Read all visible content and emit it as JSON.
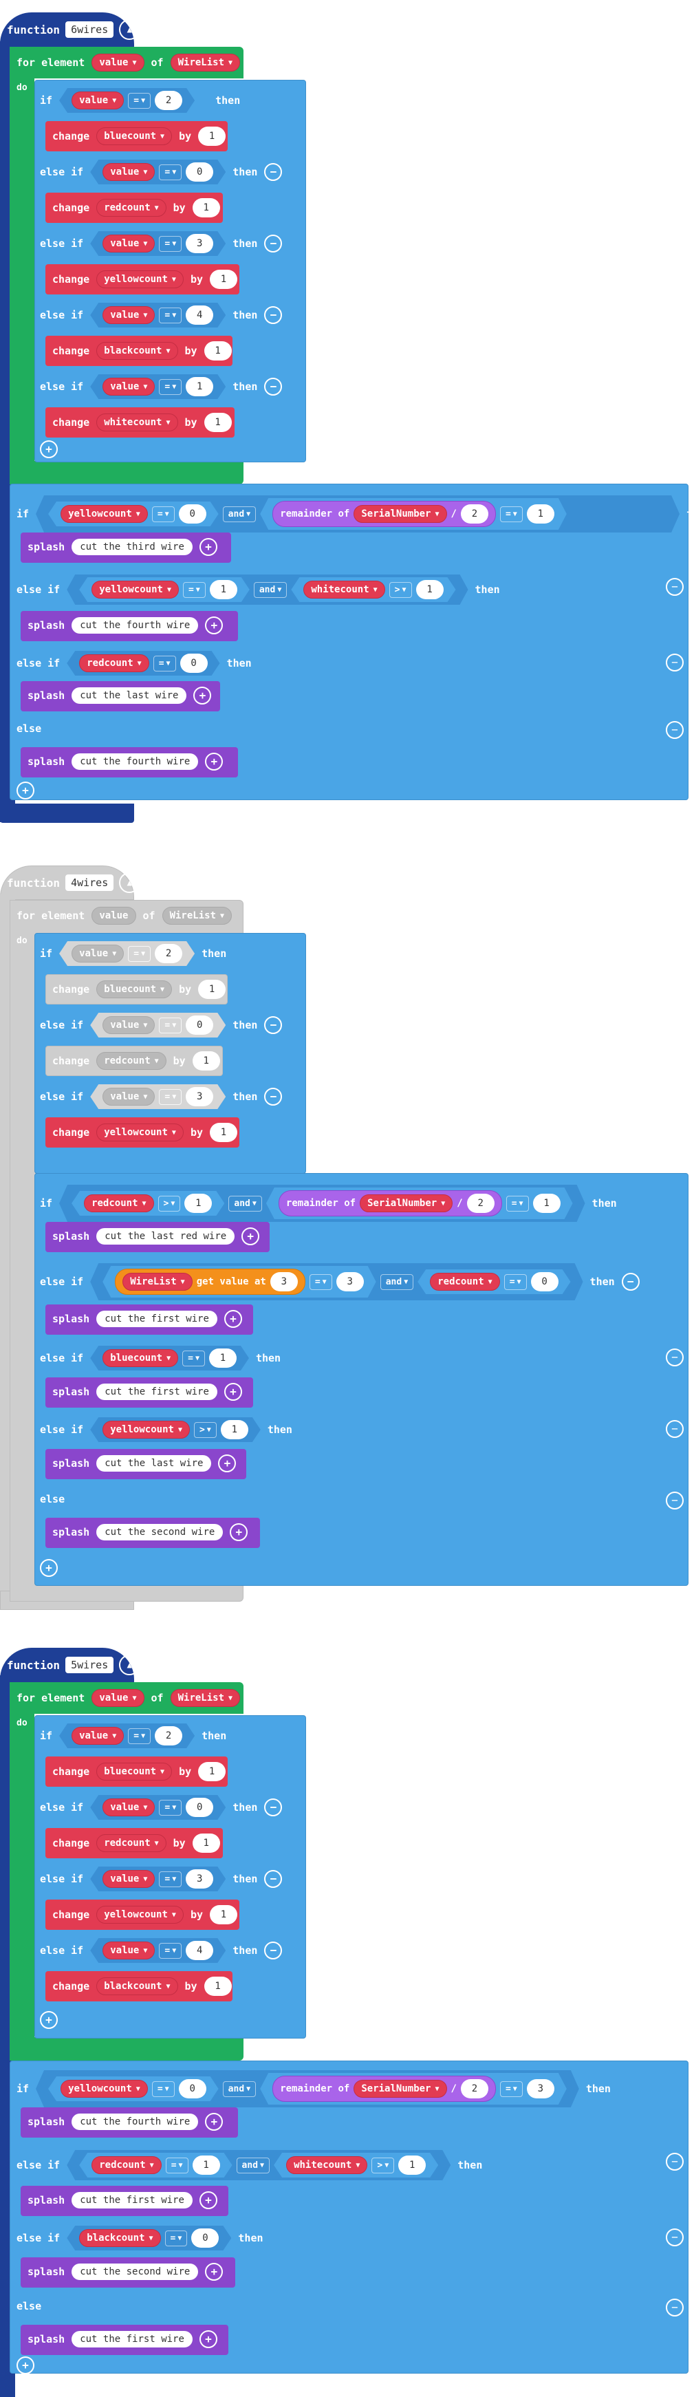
{
  "functions": [
    {
      "keyword": "function",
      "name": "6wires"
    },
    {
      "keyword": "function",
      "name": "4wires"
    },
    {
      "keyword": "function",
      "name": "5wires"
    }
  ],
  "labels": {
    "for_element": "for element",
    "of": "of",
    "do": "do",
    "if": "if",
    "else_if": "else if",
    "else": "else",
    "then": "then",
    "change": "change",
    "by": "by",
    "and": "and",
    "splash": "splash",
    "remainder_of": "remainder of",
    "get_value_at": "get value at",
    "divide": "/"
  },
  "vars": {
    "value": "value",
    "wirelist": "WireList",
    "bluecount": "bluecount",
    "redcount": "redcount",
    "yellowcount": "yellowcount",
    "blackcount": "blackcount",
    "whitecount": "whitecount",
    "serialnumber": "SerialNumber"
  },
  "ops": {
    "eq": "=",
    "gt": ">"
  },
  "nums": {
    "n0": "0",
    "n1": "1",
    "n2": "2",
    "n3": "3",
    "n4": "4"
  },
  "strings": {
    "third": "cut the third wire",
    "fourth": "cut the fourth wire",
    "last": "cut the last wire",
    "last_red": "cut the last red wire",
    "first": "cut the first wire",
    "second": "cut the second wire"
  },
  "colors": {
    "function": "#1e3f96",
    "loop": "#1fae5d",
    "logic": "#4aa5e6",
    "variable": "#e23b52",
    "text": "#8a46cc",
    "array": "#f4901b",
    "disabled": "#cecece"
  }
}
